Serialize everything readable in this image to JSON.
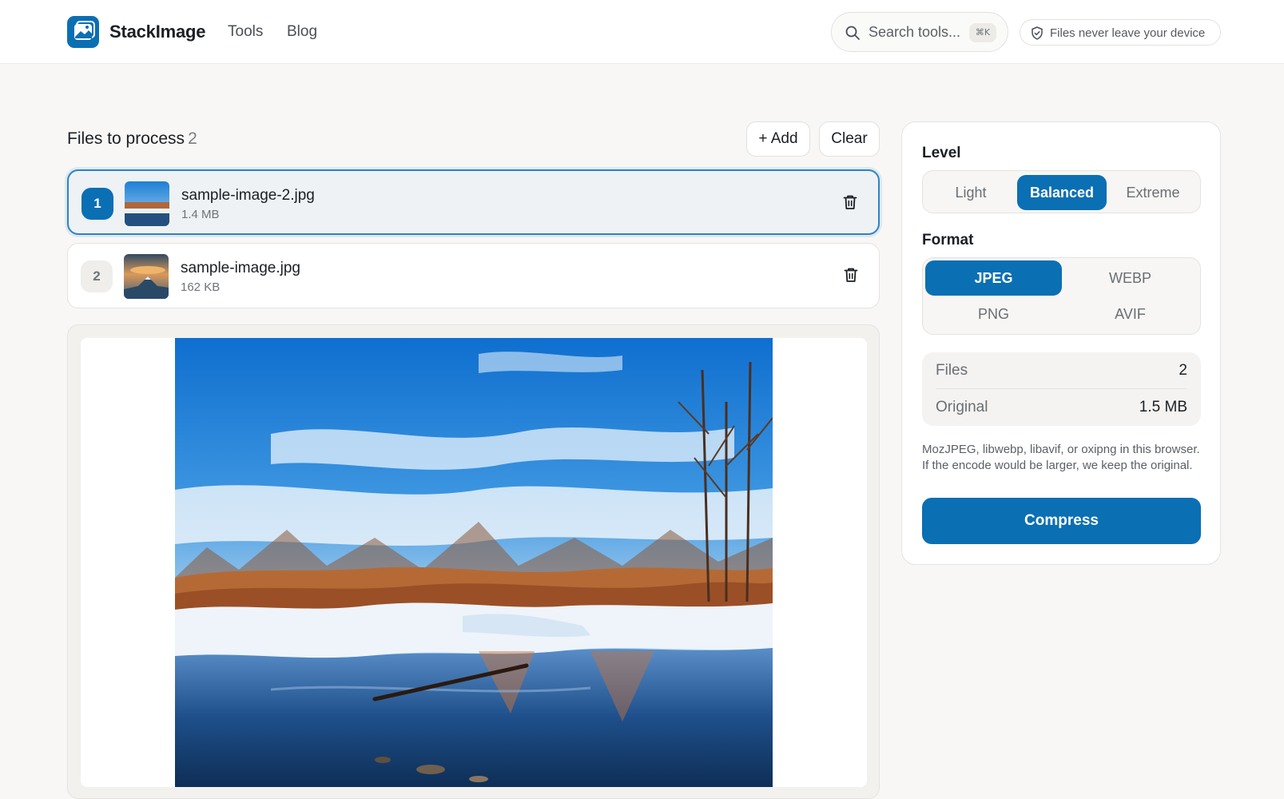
{
  "header": {
    "brand": "StackImage",
    "nav": [
      "Tools",
      "Blog"
    ],
    "search_placeholder": "Search tools...",
    "search_shortcut": "⌘K",
    "privacy_badge": "Files never leave your device"
  },
  "files": {
    "title": "Files to process",
    "count": "2",
    "add_label": "+ Add",
    "clear_label": "Clear",
    "items": [
      {
        "index": "1",
        "name": "sample-image-2.jpg",
        "size": "1.4 MB",
        "selected": true
      },
      {
        "index": "2",
        "name": "sample-image.jpg",
        "size": "162 KB",
        "selected": false
      }
    ]
  },
  "settings": {
    "level_label": "Level",
    "levels": [
      "Light",
      "Balanced",
      "Extreme"
    ],
    "level_selected": "Balanced",
    "format_label": "Format",
    "formats": [
      "JPEG",
      "WEBP",
      "PNG",
      "AVIF"
    ],
    "format_selected": "JPEG",
    "stats": [
      {
        "label": "Files",
        "value": "2"
      },
      {
        "label": "Original",
        "value": "1.5 MB"
      }
    ],
    "note": "MozJPEG, libwebp, libavif, or oxipng in this browser. If the encode would be larger, we keep the original.",
    "compress_label": "Compress"
  },
  "colors": {
    "accent": "#0b6fb3",
    "background": "#f8f7f5"
  }
}
